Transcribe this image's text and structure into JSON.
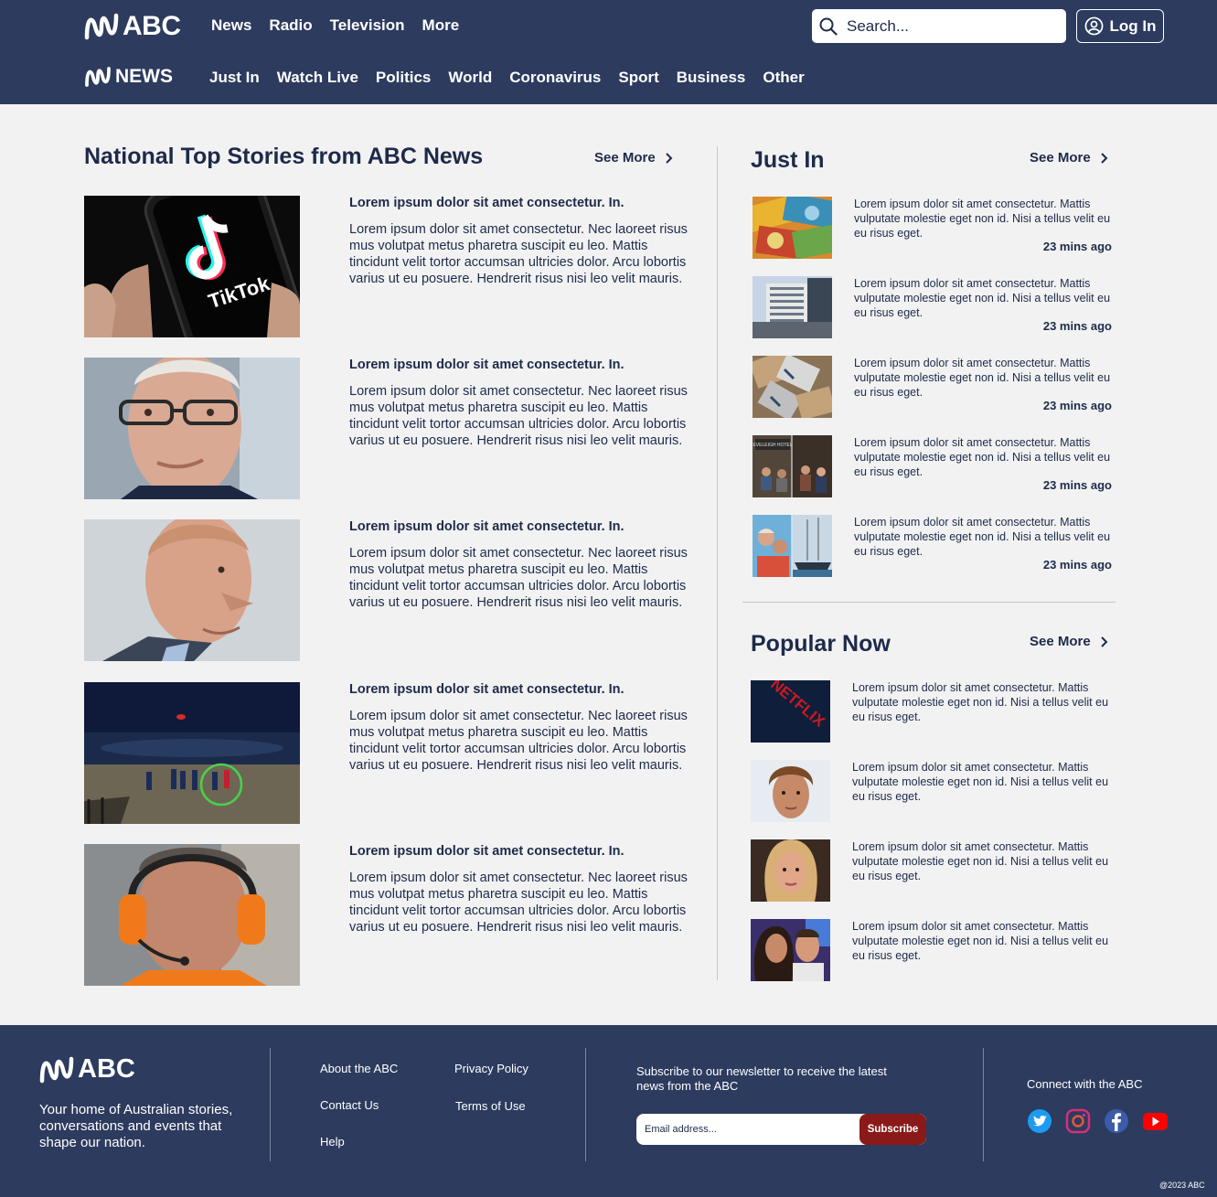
{
  "header": {
    "brand": "ABC",
    "nav": [
      "News",
      "Radio",
      "Television",
      "More"
    ],
    "news_brand": "NEWS",
    "subnav": [
      "Just In",
      "Watch Live",
      "Politics",
      "World",
      "Coronavirus",
      "Sport",
      "Business",
      "Other"
    ],
    "search_placeholder": "Search...",
    "login_label": "Log In"
  },
  "top_stories": {
    "heading": "National Top Stories from ABC News",
    "see_more": "See More",
    "items": [
      {
        "title": "Lorem ipsum dolor sit amet consectetur. In.",
        "body": "Lorem ipsum dolor sit amet consectetur. Nec laoreet risus mus volutpat metus pharetra suscipit eu leo. Mattis tincidunt velit tortor accumsan ultricies dolor. Arcu lobortis varius ut eu posuere. Hendrerit risus nisi leo velit mauris.",
        "image_text": "TikTok"
      },
      {
        "title": "Lorem ipsum dolor sit amet consectetur. In.",
        "body": "Lorem ipsum dolor sit amet consectetur. Nec laoreet risus mus volutpat metus pharetra suscipit eu leo. Mattis tincidunt velit tortor accumsan ultricies dolor. Arcu lobortis varius ut eu posuere. Hendrerit risus nisi leo velit mauris."
      },
      {
        "title": "Lorem ipsum dolor sit amet consectetur. In.",
        "body": "Lorem ipsum dolor sit amet consectetur. Nec laoreet risus mus volutpat metus pharetra suscipit eu leo. Mattis tincidunt velit tortor accumsan ultricies dolor. Arcu lobortis varius ut eu posuere. Hendrerit risus nisi leo velit mauris."
      },
      {
        "title": "Lorem ipsum dolor sit amet consectetur. In.",
        "body": "Lorem ipsum dolor sit amet consectetur. Nec laoreet risus mus volutpat metus pharetra suscipit eu leo. Mattis tincidunt velit tortor accumsan ultricies dolor. Arcu lobortis varius ut eu posuere. Hendrerit risus nisi leo velit mauris."
      },
      {
        "title": "Lorem ipsum dolor sit amet consectetur. In.",
        "body": "Lorem ipsum dolor sit amet consectetur. Nec laoreet risus mus volutpat metus pharetra suscipit eu leo. Mattis tincidunt velit tortor accumsan ultricies dolor. Arcu lobortis varius ut eu posuere. Hendrerit risus nisi leo velit mauris."
      }
    ]
  },
  "just_in": {
    "heading": "Just In",
    "see_more": "See More",
    "items": [
      {
        "text": "Lorem ipsum dolor sit amet consectetur. Mattis vulputate molestie eget non id. Nisi a tellus velit eu eu risus eget.",
        "time": "23 mins ago"
      },
      {
        "text": "Lorem ipsum dolor sit amet consectetur. Mattis vulputate molestie eget non id. Nisi a tellus velit eu eu risus eget.",
        "time": "23 mins ago"
      },
      {
        "text": "Lorem ipsum dolor sit amet consectetur. Mattis vulputate molestie eget non id. Nisi a tellus velit eu eu risus eget.",
        "time": "23 mins ago"
      },
      {
        "text": "Lorem ipsum dolor sit amet consectetur. Mattis vulputate molestie eget non id. Nisi a tellus velit eu eu risus eget.",
        "time": "23 mins ago",
        "image_text": "EVELEIGH HOTEL"
      },
      {
        "text": "Lorem ipsum dolor sit amet consectetur. Mattis vulputate molestie eget non id. Nisi a tellus velit eu eu risus eget.",
        "time": "23 mins ago"
      }
    ]
  },
  "popular": {
    "heading": "Popular Now",
    "see_more": "See More",
    "items": [
      {
        "text": "Lorem ipsum dolor sit amet consectetur. Mattis vulputate molestie eget non id. Nisi a tellus velit eu eu risus eget.",
        "image_text": "NETFLIX"
      },
      {
        "text": "Lorem ipsum dolor sit amet consectetur. Mattis vulputate molestie eget non id. Nisi a tellus velit eu eu risus eget."
      },
      {
        "text": "Lorem ipsum dolor sit amet consectetur. Mattis vulputate molestie eget non id. Nisi a tellus velit eu eu risus eget."
      },
      {
        "text": "Lorem ipsum dolor sit amet consectetur. Mattis vulputate molestie eget non id. Nisi a tellus velit eu eu risus eget."
      }
    ]
  },
  "footer": {
    "brand": "ABC",
    "tagline": "Your home of Australian stories, conversations and events that shape our nation.",
    "links_col1": [
      "About the ABC",
      "Contact Us",
      "Help"
    ],
    "links_col2": [
      "Privacy Policy",
      "Terms of Use"
    ],
    "subscribe_text": "Subscribe to our newsletter to receive the latest news from the ABC",
    "email_placeholder": "Email address...",
    "subscribe_label": "Subscribe",
    "connect_label": "Connect with the ABC",
    "social": [
      "twitter-icon",
      "instagram-icon",
      "facebook-icon",
      "youtube-icon"
    ],
    "copyright": "@2023 ABC"
  },
  "colors": {
    "navy": "#2c3b5e",
    "page_bg": "#f2f2f2",
    "text": "#1e2a4a",
    "subscribe_red": "#8a1a1a"
  }
}
